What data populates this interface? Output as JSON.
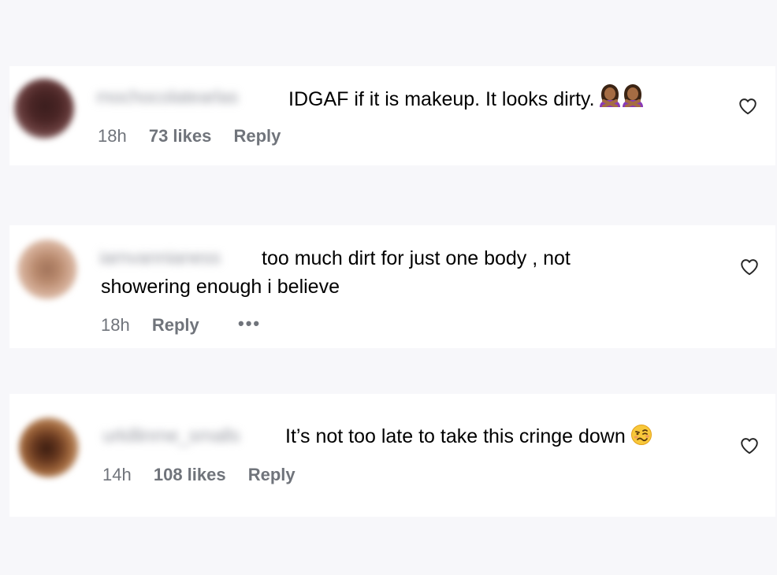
{
  "comments": [
    {
      "username": "mochocolatearlas",
      "text": "IDGAF if it is makeup. It looks dirty.",
      "time": "18h",
      "likes": "73 likes",
      "reply": "Reply"
    },
    {
      "username": "iamvannianess",
      "text_line1": "too much dirt for just one body , not",
      "text_line2": "showering enough i believe",
      "time": "18h",
      "reply": "Reply",
      "more": "•••"
    },
    {
      "username": "urkillinme_smalls",
      "text": "It’s not too late to take this cringe down",
      "time": "14h",
      "likes": "108 likes",
      "reply": "Reply"
    }
  ],
  "icons": {
    "like": "heart-outline-icon",
    "emoji1": "woman-gesturing-no-emoji",
    "emoji2": "woozy-face-emoji"
  },
  "colors": {
    "background": "#f7f7fa",
    "card": "#ffffff",
    "meta_text": "#70747b"
  }
}
